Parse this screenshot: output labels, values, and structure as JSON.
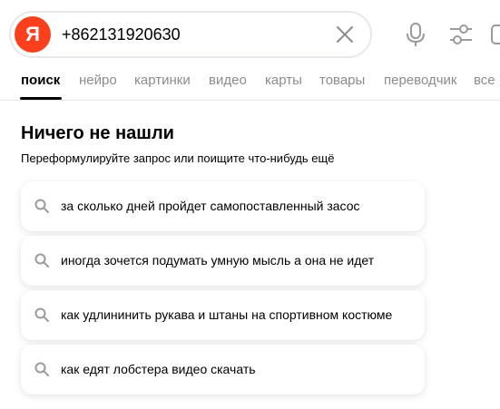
{
  "header": {
    "logo_letter": "Я",
    "search_value": "+862131920630"
  },
  "tabs": [
    {
      "label": "поиск",
      "active": true
    },
    {
      "label": "нейро"
    },
    {
      "label": "картинки"
    },
    {
      "label": "видео"
    },
    {
      "label": "карты"
    },
    {
      "label": "товары"
    },
    {
      "label": "переводчик"
    },
    {
      "label": "все"
    }
  ],
  "results": {
    "title": "Ничего не нашли",
    "subtitle": "Переформулируйте запрос или поищите что-нибудь ещё",
    "suggestions": [
      "за сколько дней пройдет самопоставленный засос",
      "иногда зочется подумать умную мысль а она не идет",
      "как удлининить рукава и штаны на спортивном костюме",
      "как едят лобстера видео скачать"
    ]
  },
  "colors": {
    "logo": "#fc3f1d",
    "inactive_tab": "#8c8c8c",
    "icon": "#9a9a9a"
  },
  "icons": {
    "clear": "close-icon",
    "mic": "microphone-icon",
    "settings": "filters-icon",
    "suggestion": "search-icon"
  }
}
